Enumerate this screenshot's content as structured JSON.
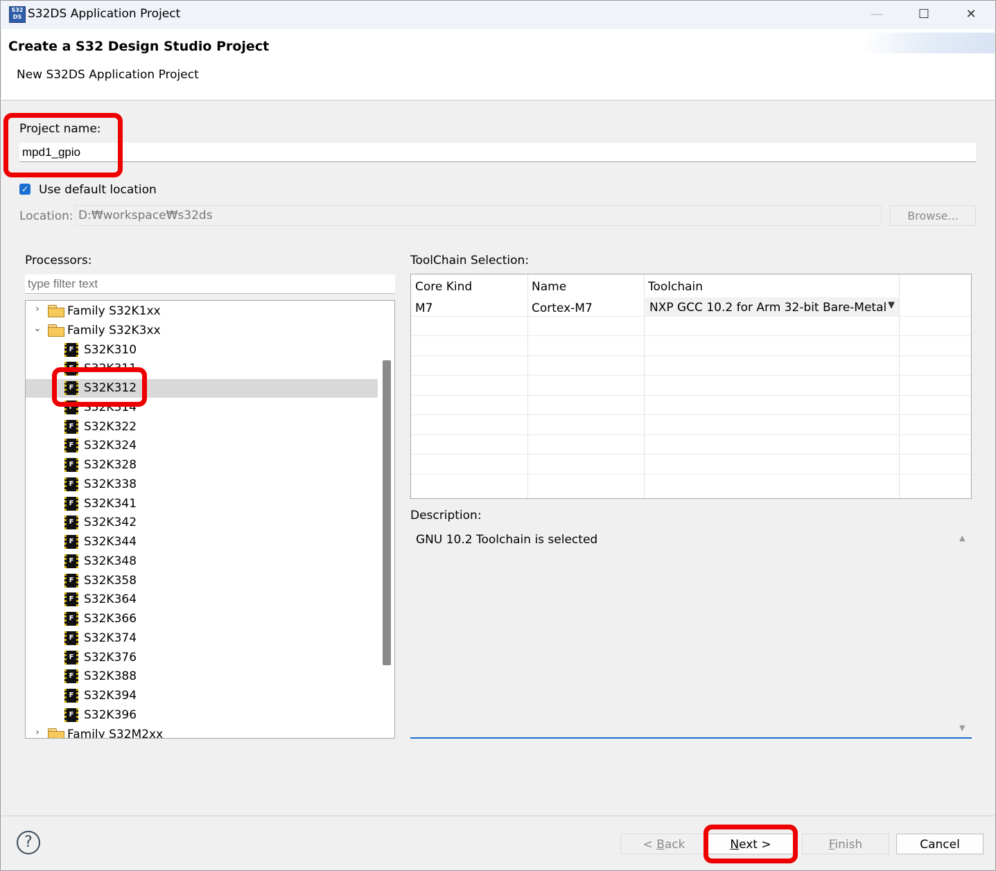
{
  "window": {
    "title": "S32DS Application Project",
    "icon_text": "S32 DS",
    "minimize": "—",
    "maximize": "☐",
    "close": "✕"
  },
  "header": {
    "title": "Create a S32 Design Studio Project",
    "subtitle": "New S32DS Application Project"
  },
  "form": {
    "project_name_label": "Project name:",
    "project_name_value": "mpd1_gpio",
    "use_default_location_label": "Use default location",
    "use_default_location_checked": true,
    "location_label": "Location:",
    "location_value": "D:₩workspace₩s32ds",
    "browse_label": "Browse..."
  },
  "processors": {
    "label": "Processors:",
    "filter_placeholder": "type filter text",
    "tree": [
      {
        "type": "family",
        "label": "Family S32K1xx",
        "expanded": false
      },
      {
        "type": "family",
        "label": "Family S32K3xx",
        "expanded": true
      },
      {
        "type": "chip",
        "label": "S32K310"
      },
      {
        "type": "chip",
        "label": "S32K311"
      },
      {
        "type": "chip",
        "label": "S32K312",
        "selected": true
      },
      {
        "type": "chip",
        "label": "S32K314"
      },
      {
        "type": "chip",
        "label": "S32K322"
      },
      {
        "type": "chip",
        "label": "S32K324"
      },
      {
        "type": "chip",
        "label": "S32K328"
      },
      {
        "type": "chip",
        "label": "S32K338"
      },
      {
        "type": "chip",
        "label": "S32K341"
      },
      {
        "type": "chip",
        "label": "S32K342"
      },
      {
        "type": "chip",
        "label": "S32K344"
      },
      {
        "type": "chip",
        "label": "S32K348"
      },
      {
        "type": "chip",
        "label": "S32K358"
      },
      {
        "type": "chip",
        "label": "S32K364"
      },
      {
        "type": "chip",
        "label": "S32K366"
      },
      {
        "type": "chip",
        "label": "S32K374"
      },
      {
        "type": "chip",
        "label": "S32K376"
      },
      {
        "type": "chip",
        "label": "S32K388"
      },
      {
        "type": "chip",
        "label": "S32K394"
      },
      {
        "type": "chip",
        "label": "S32K396"
      },
      {
        "type": "family",
        "label": "Family S32M2xx",
        "expanded": false
      }
    ],
    "chip_icon_glyph": "F"
  },
  "toolchain": {
    "label": "ToolChain Selection:",
    "columns": [
      "Core Kind",
      "Name",
      "Toolchain"
    ],
    "rows": [
      {
        "core_kind": "M7",
        "name": "Cortex-M7",
        "toolchain": "NXP GCC 10.2 for Arm 32-bit Bare-Metal"
      }
    ]
  },
  "description": {
    "label": "Description:",
    "text": "GNU 10.2 Toolchain is selected"
  },
  "buttons": {
    "help": "?",
    "back_prefix": "< ",
    "back_key": "B",
    "back_rest": "ack",
    "next_key": "N",
    "next_rest": "ext >",
    "finish_key": "F",
    "finish_rest": "inish",
    "cancel": "Cancel"
  },
  "colors": {
    "highlight": "#ee0000",
    "accent": "#1a6fd1"
  }
}
